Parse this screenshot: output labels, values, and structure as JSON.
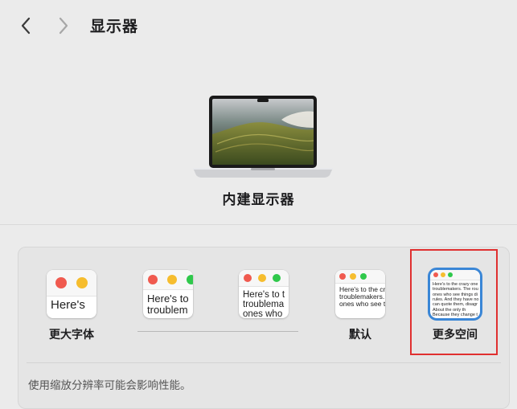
{
  "toolbar": {
    "title": "显示器",
    "back_icon": "chevron-left-icon",
    "forward_icon": "chevron-right-icon"
  },
  "display": {
    "name": "内建显示器"
  },
  "resolution": {
    "options": [
      {
        "label": "更大字体",
        "preview": "Here's",
        "selected": false
      },
      {
        "label": "",
        "preview": "Here's to\ntroublem",
        "selected": false
      },
      {
        "label": "",
        "preview": "Here's to t\ntroublema\nones who",
        "selected": false
      },
      {
        "label": "默认",
        "preview": "Here's to the cr\ntroublemakers.\nones who see t",
        "selected": false
      },
      {
        "label": "更多空间",
        "preview": "Here's to the crazy one\ntroublemakers. The rou\nones who see things di\nrules. And they have no\ncan quote them, disagr\nAbout the only th\nBecause they change t",
        "selected": true
      }
    ],
    "note": "使用缩放分辨率可能会影响性能。"
  },
  "colors": {
    "accent": "#3a86d6",
    "highlight": "#e03030",
    "traffic_red": "#f05a4f",
    "traffic_yellow": "#f6bd2e",
    "traffic_green": "#2fc84b"
  }
}
